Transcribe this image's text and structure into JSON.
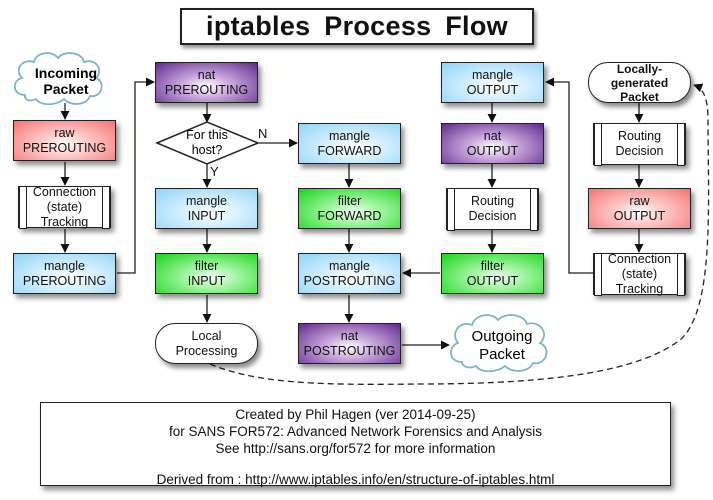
{
  "title": "iptables  Process Flow",
  "nodes": {
    "incoming_packet": [
      "Incoming",
      "Packet"
    ],
    "raw_prerouting": [
      "raw",
      "PREROUTING"
    ],
    "conntrack_in": [
      "Connection",
      "(state)",
      "Tracking"
    ],
    "mangle_prerouting": [
      "mangle",
      "PREROUTING"
    ],
    "nat_prerouting": [
      "nat",
      "PREROUTING"
    ],
    "decision": [
      "For this",
      "host?"
    ],
    "decision_yes": "Y",
    "decision_no": "N",
    "mangle_input": [
      "mangle",
      "INPUT"
    ],
    "filter_input": [
      "filter",
      "INPUT"
    ],
    "local_processing": [
      "Local",
      "Processing"
    ],
    "mangle_forward": [
      "mangle",
      "FORWARD"
    ],
    "filter_forward": [
      "filter",
      "FORWARD"
    ],
    "mangle_postrouting": [
      "mangle",
      "POSTROUTING"
    ],
    "nat_postrouting": [
      "nat",
      "POSTROUTING"
    ],
    "outgoing_packet": [
      "Outgoing",
      "Packet"
    ],
    "mangle_output": [
      "mangle",
      "OUTPUT"
    ],
    "nat_output": [
      "nat",
      "OUTPUT"
    ],
    "routing_decision_mid": [
      "Routing",
      "Decision"
    ],
    "filter_output": [
      "filter",
      "OUTPUT"
    ],
    "locally_generated": [
      "Locally-",
      "generated",
      "Packet"
    ],
    "routing_decision_right": [
      "Routing",
      "Decision"
    ],
    "raw_output": [
      "raw",
      "OUTPUT"
    ],
    "conntrack_out": [
      "Connection",
      "(state)",
      "Tracking"
    ]
  },
  "footer": {
    "line1": "Created by Phil Hagen (ver 2014-09-25)",
    "line2": "for SANS FOR572: Advanced Network Forensics and Analysis",
    "line3": "See http://sans.org/for572 for more information",
    "line4": "Derived from : http://www.iptables.info/en/structure-of-iptables.html"
  },
  "colors": {
    "mangle": "#8fd3f7",
    "filter": "#18d418",
    "raw": "#f27373",
    "nat": "#5e2a8c",
    "cloud": "#7fb3c4"
  }
}
